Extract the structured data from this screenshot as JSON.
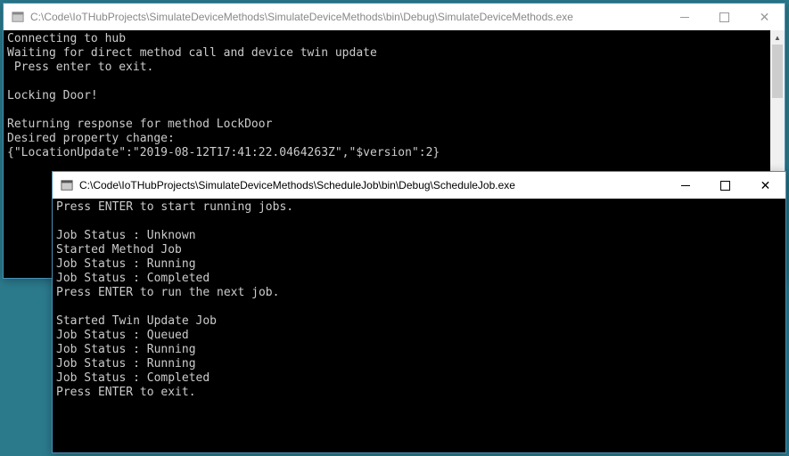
{
  "window1": {
    "title": "C:\\Code\\IoTHubProjects\\SimulateDeviceMethods\\SimulateDeviceMethods\\bin\\Debug\\SimulateDeviceMethods.exe",
    "lines": [
      "Connecting to hub",
      "Waiting for direct method call and device twin update",
      " Press enter to exit.",
      "",
      "Locking Door!",
      "",
      "Returning response for method LockDoor",
      "Desired property change:",
      "{\"LocationUpdate\":\"2019-08-12T17:41:22.0464263Z\",\"$version\":2}"
    ]
  },
  "window2": {
    "title": "C:\\Code\\IoTHubProjects\\SimulateDeviceMethods\\ScheduleJob\\bin\\Debug\\ScheduleJob.exe",
    "lines": [
      "Press ENTER to start running jobs.",
      "",
      "Job Status : Unknown",
      "Started Method Job",
      "Job Status : Running",
      "Job Status : Completed",
      "Press ENTER to run the next job.",
      "",
      "Started Twin Update Job",
      "Job Status : Queued",
      "Job Status : Running",
      "Job Status : Running",
      "Job Status : Completed",
      "Press ENTER to exit."
    ]
  },
  "controls": {
    "minimize": "min",
    "maximize": "max",
    "close": "✕"
  }
}
